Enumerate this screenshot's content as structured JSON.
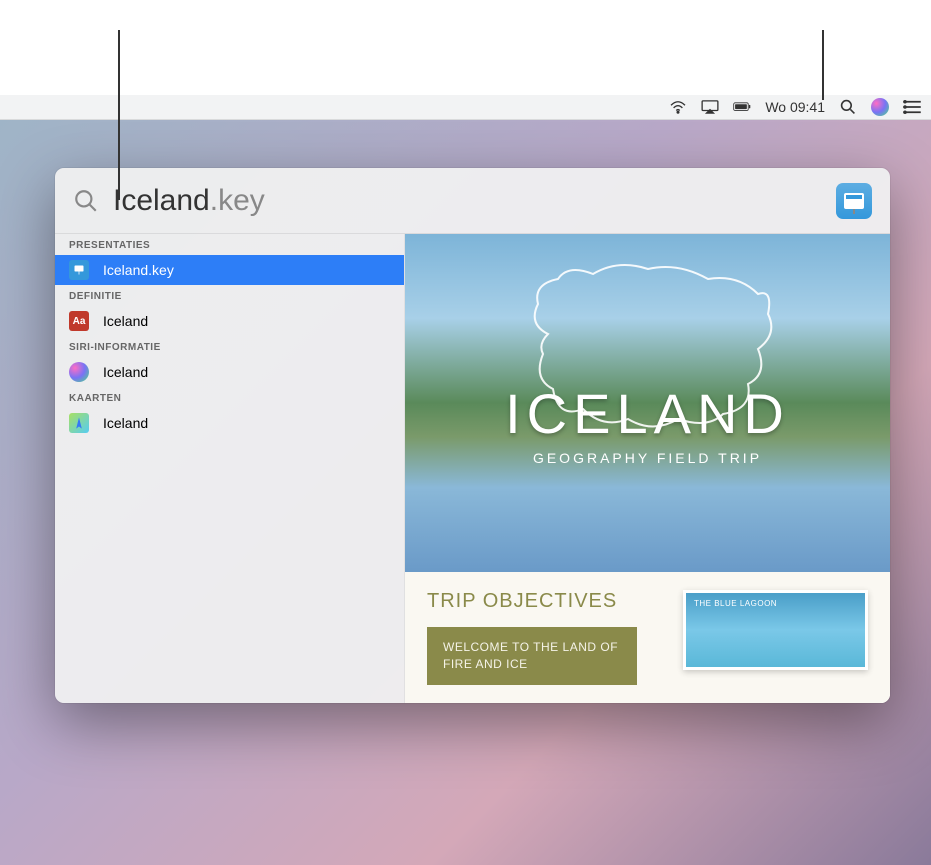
{
  "menubar": {
    "time": "Wo 09:41"
  },
  "spotlight": {
    "search_query": "Iceland",
    "search_extension": ".key",
    "categories": [
      {
        "header": "PRESENTATIES",
        "items": [
          {
            "label": "Iceland.key",
            "icon": "keynote",
            "selected": true
          }
        ]
      },
      {
        "header": "DEFINITIE",
        "items": [
          {
            "label": "Iceland",
            "icon": "dictionary",
            "selected": false
          }
        ]
      },
      {
        "header": "SIRI-INFORMATIE",
        "items": [
          {
            "label": "Iceland",
            "icon": "siri",
            "selected": false
          }
        ]
      },
      {
        "header": "KAARTEN",
        "items": [
          {
            "label": "Iceland",
            "icon": "maps",
            "selected": false
          }
        ]
      }
    ]
  },
  "preview": {
    "slide1": {
      "title": "ICELAND",
      "subtitle": "GEOGRAPHY FIELD TRIP"
    },
    "slide2": {
      "heading": "TRIP OBJECTIVES",
      "button_text": "WELCOME TO THE LAND OF FIRE AND ICE",
      "image_caption": "THE BLUE LAGOON"
    }
  }
}
